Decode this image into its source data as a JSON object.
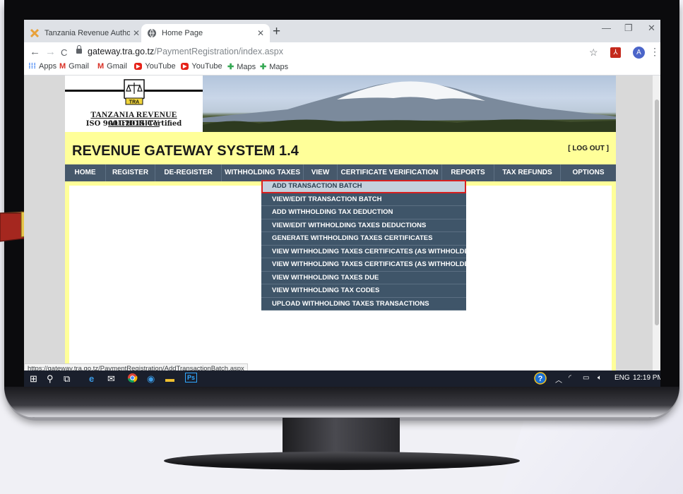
{
  "browser": {
    "tabs": [
      {
        "title": "Tanzania Revenue Authority - Ho",
        "active": false
      },
      {
        "title": "Home Page",
        "active": true
      }
    ],
    "new_tab": "+",
    "window_controls": {
      "minimize": "—",
      "maximize": "❐",
      "close": "✕"
    },
    "nav": {
      "back": "←",
      "forward": "→",
      "reload": "C"
    },
    "url_host": "gateway.tra.go.tz",
    "url_path": "/PaymentRegistration/index.aspx",
    "bookmarks": [
      {
        "label": "Apps",
        "icon": "apps-grid-icon"
      },
      {
        "label": "Gmail",
        "icon": "gmail-icon"
      },
      {
        "label": "Gmail",
        "icon": "gmail-icon"
      },
      {
        "label": "YouTube",
        "icon": "youtube-icon"
      },
      {
        "label": "YouTube",
        "icon": "youtube-icon"
      },
      {
        "label": "Maps",
        "icon": "maps-icon"
      },
      {
        "label": "Maps",
        "icon": "maps-icon"
      }
    ],
    "profile_initial": "A",
    "status_url": "https://gateway.tra.go.tz/PaymentRegistration/AddTransactionBatch.aspx"
  },
  "site": {
    "org_name": "TANZANIA REVENUE AUTHORITY",
    "certification": "ISO 9001:2015 Certified",
    "emblem_text": "TRA",
    "system_title": "REVENUE GATEWAY SYSTEM 1.4",
    "logout": "[ LOG OUT ]",
    "menu": [
      "HOME",
      "REGISTER",
      "DE-REGISTER",
      "WITHHOLDING TAXES",
      "VIEW",
      "CERTIFICATE VERIFICATION",
      "REPORTS",
      "TAX REFUNDS",
      "OPTIONS"
    ],
    "dropdown": [
      "ADD TRANSACTION BATCH",
      "VIEW/EDIT TRANSACTION BATCH",
      "ADD WITHHOLDING TAX DEDUCTION",
      "VIEW/EDIT WITHHOLDING TAXES DEDUCTIONS",
      "GENERATE WITHHOLDING TAXES CERTIFICATES",
      "VIEW WITHHOLDING TAXES CERTIFICATES (AS WITHHOLDER)",
      "VIEW WITHHOLDING TAXES CERTIFICATES (AS WITHHOLDEE)",
      "VIEW WITHHOLDING TAXES DUE",
      "VIEW WITHHOLDING TAX CODES",
      "UPLOAD WITHHOLDING TAXES TRANSACTIONS"
    ],
    "highlighted_index": 0
  },
  "taskbar": {
    "lang": "ENG",
    "time": "12:19 PM",
    "ps_label": "Ps"
  },
  "colors": {
    "site_yellow": "#ffff99",
    "menu_bg": "#46586b",
    "dropdown_bg": "#3f5569",
    "highlight_outline": "#d72020"
  }
}
